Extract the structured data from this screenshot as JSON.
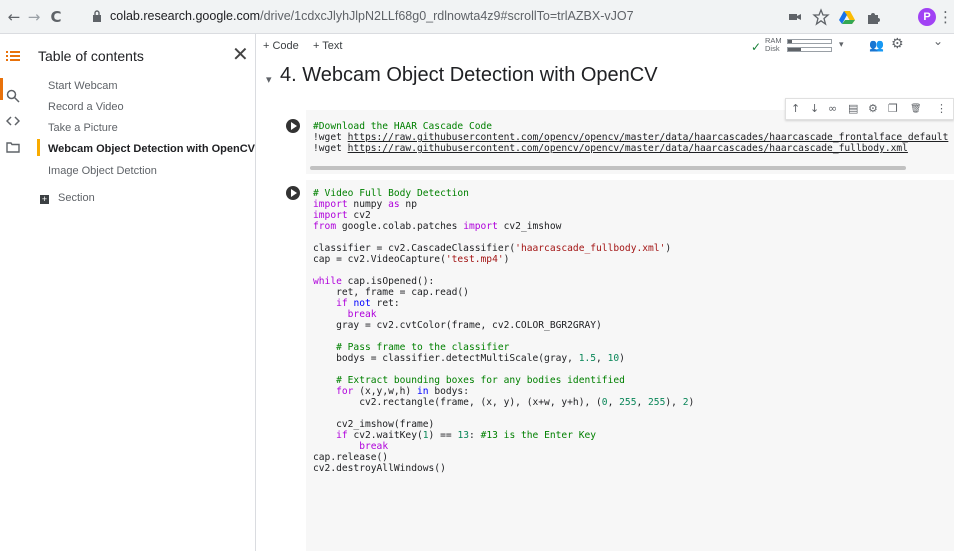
{
  "browser": {
    "back": "←",
    "forward": "→",
    "reload": "C",
    "url_host": "colab.research.google.com",
    "url_path": "/drive/1cdxcJlyhJlpN2LLf68g0_rdlnowta4z9#scrollTo=trlAZBX-vJO7",
    "profile_initial": "P"
  },
  "toc": {
    "title": "Table of contents",
    "close": "✕",
    "items": [
      {
        "label": "Start Webcam",
        "active": false
      },
      {
        "label": "Record a Video",
        "active": false
      },
      {
        "label": "Take a Picture",
        "active": false
      },
      {
        "label": "Webcam Object Detection with OpenCV",
        "active": true
      },
      {
        "label": "Image Object Detction",
        "active": false
      }
    ],
    "section_label": "Section",
    "section_icon": "+"
  },
  "toolbar": {
    "add_code": "+ Code",
    "add_text": "+ Text",
    "connected_check": "✓",
    "ram_label": "RAM",
    "disk_label": "Disk",
    "ram_usage": 0.1,
    "disk_usage": 0.3,
    "dropdown": "▾",
    "people_icon": "👥",
    "settings_icon": "⚙",
    "collapse_icon": "⌄"
  },
  "heading": {
    "caret": "▾",
    "text": "4. Webcam Object Detection with OpenCV"
  },
  "cell_toolbar": [
    "↑",
    "↓",
    "∞",
    "▤",
    "⚙",
    "❐",
    "🗑",
    "⋮"
  ],
  "cell1": {
    "comment": "#Download the HAAR Cascade Code",
    "line1_cmd": "!wget ",
    "line1_url": "https://raw.githubusercontent.com/opencv/opencv/master/data/haarcascades/haarcascade_frontalface_default",
    "line2_cmd": "!wget ",
    "line2_url": "https://raw.githubusercontent.com/opencv/opencv/master/data/haarcascades/haarcascade_fullbody.xml"
  },
  "cell2": {
    "lines": [
      [
        {
          "t": "# Video Full Body Detection",
          "c": "cm"
        }
      ],
      [
        {
          "t": "import",
          "c": "kw"
        },
        {
          "t": " numpy "
        },
        {
          "t": "as",
          "c": "kw"
        },
        {
          "t": " np"
        }
      ],
      [
        {
          "t": "import",
          "c": "kw"
        },
        {
          "t": " cv2"
        }
      ],
      [
        {
          "t": "from",
          "c": "kw"
        },
        {
          "t": " google.colab.patches "
        },
        {
          "t": "import",
          "c": "kw"
        },
        {
          "t": " cv2_imshow"
        }
      ],
      [
        {
          "t": ""
        }
      ],
      [
        {
          "t": "classifier = cv2.CascadeClassifier("
        },
        {
          "t": "'haarcascade_fullbody.xml'",
          "c": "st"
        },
        {
          "t": ")"
        }
      ],
      [
        {
          "t": "cap = cv2.VideoCapture("
        },
        {
          "t": "'test.mp4'",
          "c": "st"
        },
        {
          "t": ")"
        }
      ],
      [
        {
          "t": ""
        }
      ],
      [
        {
          "t": "while",
          "c": "kw"
        },
        {
          "t": " cap.isOpened():"
        }
      ],
      [
        {
          "t": "    ret, frame = cap.read()"
        }
      ],
      [
        {
          "t": "    "
        },
        {
          "t": "if",
          "c": "kw"
        },
        {
          "t": " "
        },
        {
          "t": "not",
          "c": "kb"
        },
        {
          "t": " ret:"
        }
      ],
      [
        {
          "t": "      "
        },
        {
          "t": "break",
          "c": "kw"
        }
      ],
      [
        {
          "t": "    gray = cv2.cvtColor(frame, cv2.COLOR_BGR2GRAY)"
        }
      ],
      [
        {
          "t": ""
        }
      ],
      [
        {
          "t": "    "
        },
        {
          "t": "# Pass frame to the classifier",
          "c": "cm"
        }
      ],
      [
        {
          "t": "    bodys = classifier.detectMultiScale(gray, "
        },
        {
          "t": "1.5",
          "c": "nm"
        },
        {
          "t": ", "
        },
        {
          "t": "10",
          "c": "nm"
        },
        {
          "t": ")"
        }
      ],
      [
        {
          "t": ""
        }
      ],
      [
        {
          "t": "    "
        },
        {
          "t": "# Extract bounding boxes for any bodies identified",
          "c": "cm"
        }
      ],
      [
        {
          "t": "    "
        },
        {
          "t": "for",
          "c": "kw"
        },
        {
          "t": " (x,y,w,h) "
        },
        {
          "t": "in",
          "c": "kb"
        },
        {
          "t": " bodys:"
        }
      ],
      [
        {
          "t": "        cv2.rectangle(frame, (x, y), (x+w, y+h), ("
        },
        {
          "t": "0",
          "c": "nm"
        },
        {
          "t": ", "
        },
        {
          "t": "255",
          "c": "nm"
        },
        {
          "t": ", "
        },
        {
          "t": "255",
          "c": "nm"
        },
        {
          "t": "), "
        },
        {
          "t": "2",
          "c": "nm"
        },
        {
          "t": ")"
        }
      ],
      [
        {
          "t": ""
        }
      ],
      [
        {
          "t": "    cv2_imshow(frame)"
        }
      ],
      [
        {
          "t": "    "
        },
        {
          "t": "if",
          "c": "kw"
        },
        {
          "t": " cv2.waitKey("
        },
        {
          "t": "1",
          "c": "nm"
        },
        {
          "t": ") == "
        },
        {
          "t": "13",
          "c": "nm"
        },
        {
          "t": ": "
        },
        {
          "t": "#13 is the Enter Key",
          "c": "cm"
        }
      ],
      [
        {
          "t": "        "
        },
        {
          "t": "break",
          "c": "kw"
        }
      ],
      [
        {
          "t": "cap.release()"
        }
      ],
      [
        {
          "t": "cv2.destroyAllWindows()"
        }
      ]
    ]
  }
}
